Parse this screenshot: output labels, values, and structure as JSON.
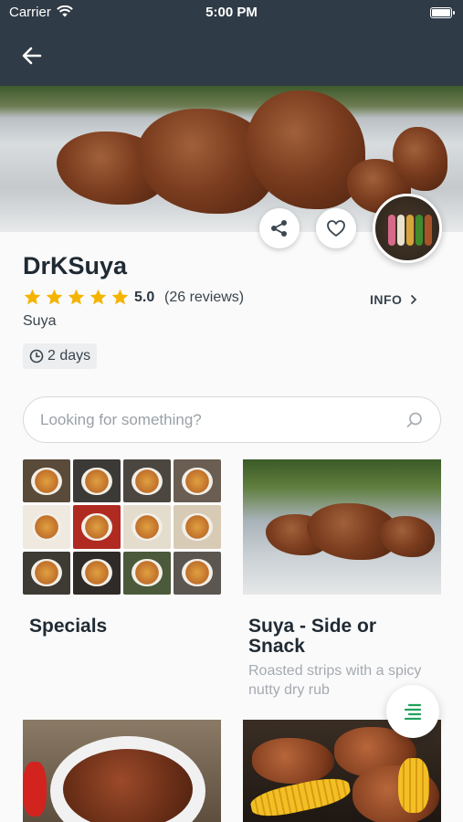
{
  "status_bar": {
    "carrier": "Carrier",
    "time": "5:00 PM"
  },
  "nav": {
    "back_icon": "arrow-left-icon"
  },
  "restaurant": {
    "name": "DrKSuya",
    "rating": "5.0",
    "rating_stars": 5,
    "reviews": "(26 reviews)",
    "info_label": "INFO",
    "cuisine": "Suya",
    "duration": "2 days",
    "star_color": "#f4b400"
  },
  "actions": {
    "share_icon": "share-icon",
    "favorite_icon": "heart-outline-icon"
  },
  "search": {
    "placeholder": "Looking for something?",
    "value": ""
  },
  "categories": [
    {
      "title": "Specials",
      "description": ""
    },
    {
      "title": "Suya - Side or Snack",
      "description": "Roasted strips with a spicy nutty dry rub"
    },
    {
      "title": "",
      "description": ""
    },
    {
      "title": "",
      "description": ""
    }
  ],
  "fab": {
    "icon": "menu-list-icon",
    "color": "#1fa25b"
  }
}
